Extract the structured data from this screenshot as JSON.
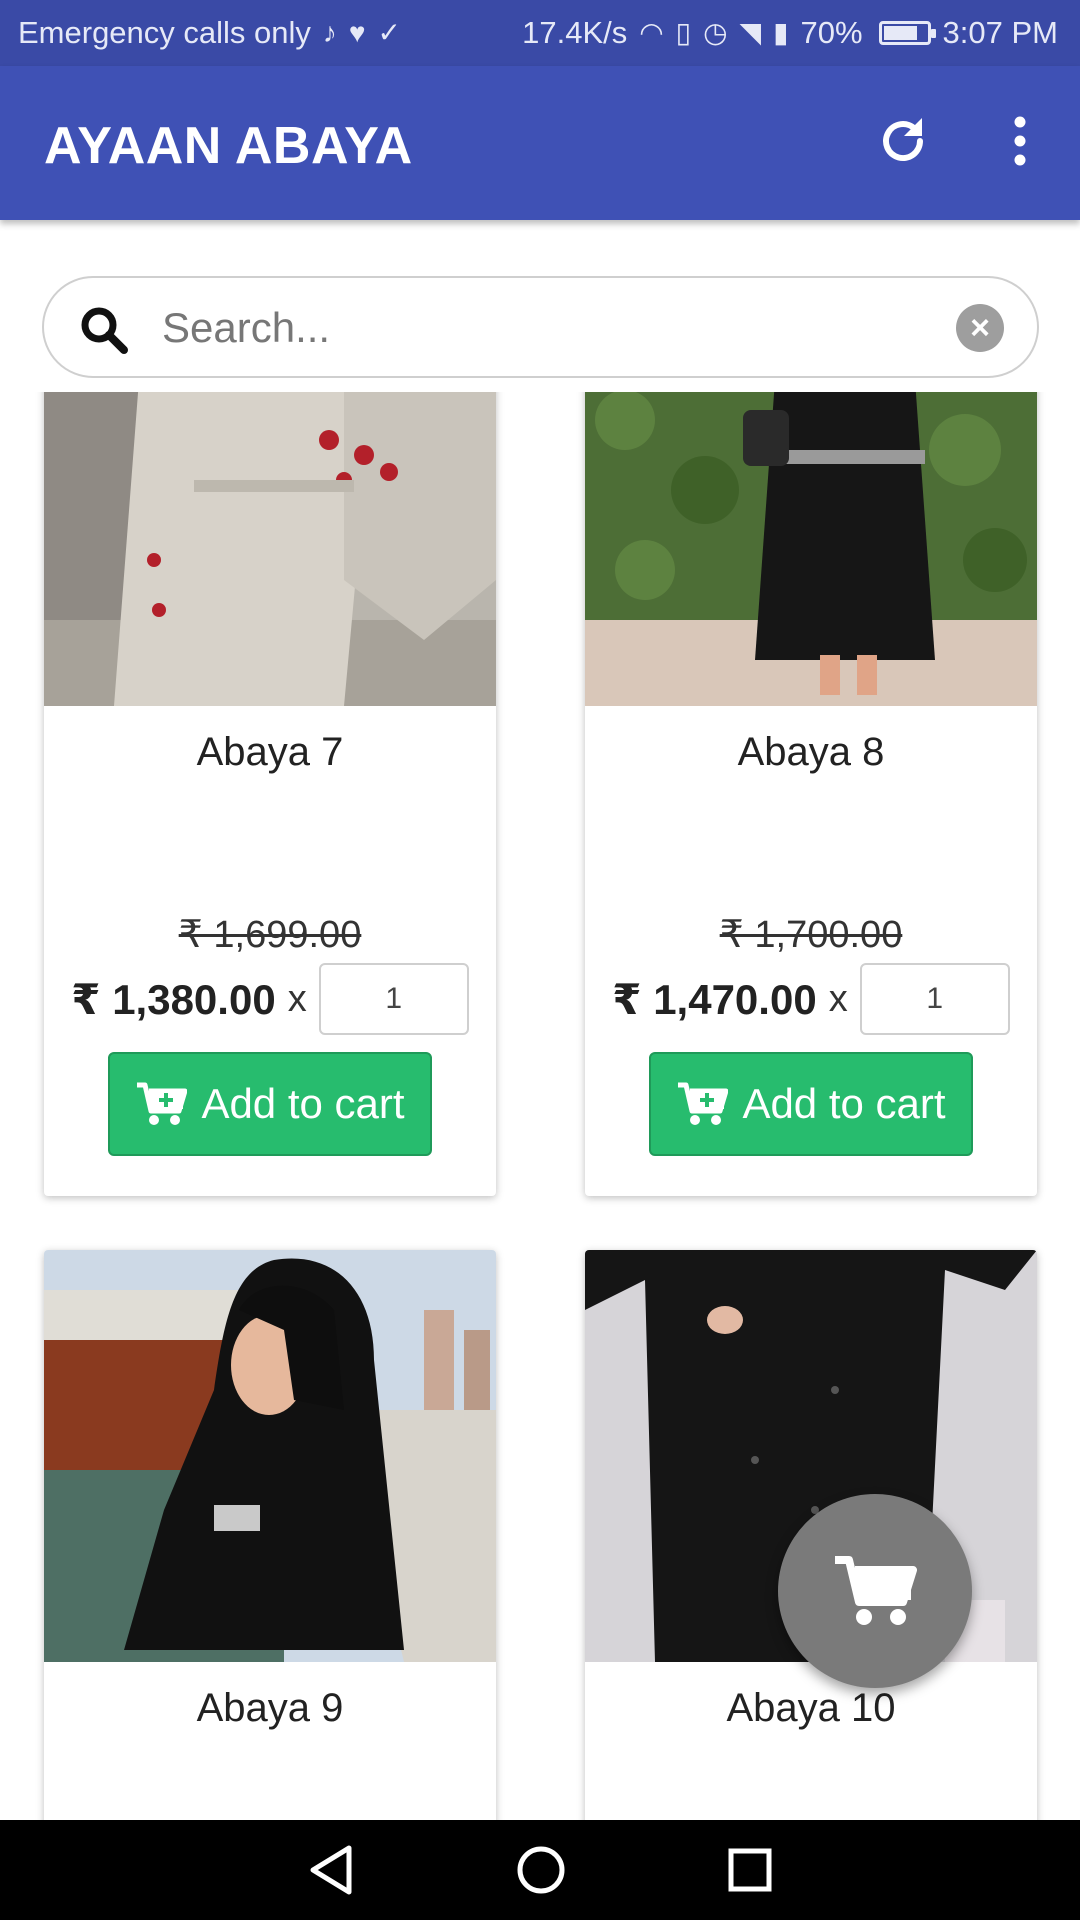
{
  "status_bar": {
    "carrier": "Emergency calls only",
    "net_speed": "17.4K/s",
    "battery": "70%",
    "time": "3:07 PM"
  },
  "app_bar": {
    "title": "AYAAN ABAYA",
    "refresh_icon": "refresh-icon",
    "more_icon": "more-vert-icon"
  },
  "search": {
    "placeholder": "Search...",
    "value": ""
  },
  "products": [
    {
      "name": "Abaya 7",
      "old_price": "₹ 1,699.00",
      "price": "₹ 1,380.00",
      "times": "x",
      "quantity": "1",
      "button": "Add to cart"
    },
    {
      "name": "Abaya 8",
      "old_price": "₹ 1,700.00",
      "price": "₹ 1,470.00",
      "times": "x",
      "quantity": "1",
      "button": "Add to cart"
    },
    {
      "name": "Abaya 9"
    },
    {
      "name": "Abaya 10"
    }
  ],
  "colors": {
    "app_bar": "#3f51b5",
    "status_bar": "#3a4aa6",
    "add_button": "#27bc6e",
    "fab": "#7a7a7a"
  }
}
